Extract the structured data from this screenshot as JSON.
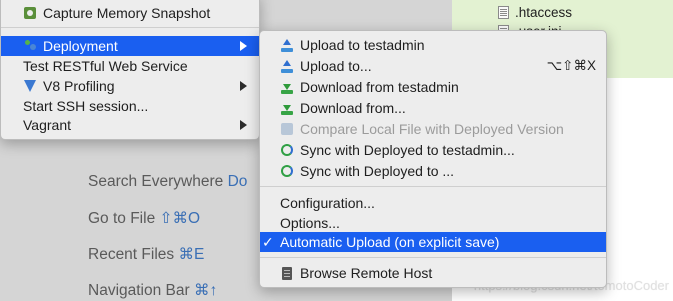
{
  "background": {
    "hints": [
      {
        "text": "Search Everywhere",
        "shortcut": "Do"
      },
      {
        "text": "Go to File",
        "shortcut": "⇧⌘O"
      },
      {
        "text": "Recent Files",
        "shortcut": "⌘E"
      },
      {
        "text": "Navigation Bar",
        "shortcut": "⌘↑"
      }
    ],
    "project_files": [
      ".htaccess",
      ".user.ini"
    ],
    "watermark": "https://blog.csdn.net/tomotoCoder"
  },
  "parent_menu": {
    "items": [
      {
        "label": "Capture Memory Snapshot",
        "icon": "camera-icon"
      },
      {
        "label": "Deployment",
        "icon": "deployment-icon",
        "submenu": true,
        "selected": true
      },
      {
        "label": "Test RESTful Web Service",
        "icon": ""
      },
      {
        "label": "V8 Profiling",
        "icon": "v8-icon",
        "submenu": true
      },
      {
        "label": "Start SSH session...",
        "icon": ""
      },
      {
        "label": "Vagrant",
        "icon": "",
        "submenu": true
      }
    ]
  },
  "deployment_submenu": {
    "items": [
      {
        "label": "Upload to testadmin",
        "icon": "upload-icon"
      },
      {
        "label": "Upload to...",
        "icon": "upload-to-icon",
        "shortcut": "⌥⇧⌘X"
      },
      {
        "label": "Download from testadmin",
        "icon": "download-icon"
      },
      {
        "label": "Download from...",
        "icon": "download-from-icon"
      },
      {
        "label": "Compare Local File with Deployed Version",
        "icon": "compare-icon",
        "disabled": true
      },
      {
        "label": "Sync with Deployed to testadmin...",
        "icon": "sync-icon"
      },
      {
        "label": "Sync with Deployed to ...",
        "icon": "sync-icon"
      },
      {
        "label": "Configuration...",
        "icon": ""
      },
      {
        "label": "Options...",
        "icon": ""
      },
      {
        "label": "Automatic Upload (on explicit save)",
        "check": "✓",
        "selected": true,
        "checked": true
      },
      {
        "label": "Browse Remote Host",
        "icon": "server-icon"
      }
    ]
  },
  "colors": {
    "selection": "#1a5ff0",
    "menu_background": "#ededed",
    "disabled_text": "#9b9b9b",
    "shortcut_blue": "#3a6fb5",
    "project_highlight": "#e3f2d2"
  }
}
